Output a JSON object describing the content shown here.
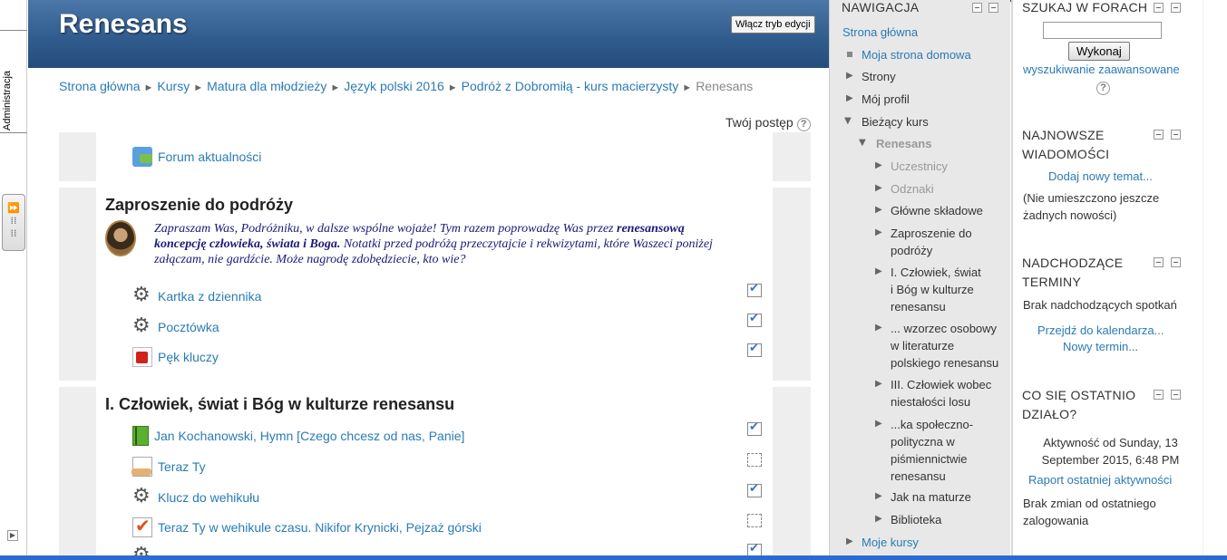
{
  "dock": {
    "admin_label": "Administracja",
    "handle_glyph": "⏩",
    "bottom_glyph": "▶"
  },
  "header": {
    "site_title": "Renesans",
    "edit_button": "Włącz tryb edycji"
  },
  "breadcrumb": {
    "items": [
      "Strona główna",
      "Kursy",
      "Matura dla młodzieży",
      "Język polski 2016",
      "Podróż z Dobromiłą - kurs macierzysty"
    ],
    "current": "Renesans",
    "separator": "►"
  },
  "progress": {
    "label": "Twój postęp",
    "help": "?"
  },
  "sections": {
    "s0": {
      "activities": [
        {
          "label": "Forum aktualności",
          "icon": "forum-icon"
        }
      ]
    },
    "s1": {
      "title": "Zaproszenie do podróży",
      "intro_a": "Zapraszam Was, Podróżniku, w dalsze wspólne wojaże! Tym razem poprowadzę Was przez ",
      "intro_b": "renesansową koncepcję człowieka, świata i Boga.",
      "intro_c": " Notatki przed podróżą przeczytajcie i rekwizytami, które Waszeci poniżej załączam, nie gardźcie. Może nagrodę zdobędziecie, kto wie?",
      "activities": [
        {
          "label": "Kartka z dziennika",
          "icon": "gear-icon",
          "done": true
        },
        {
          "label": "Pocztówka",
          "icon": "gear-icon",
          "done": true
        },
        {
          "label": "Pęk kluczy",
          "icon": "pdf-icon",
          "done": true
        }
      ]
    },
    "s2": {
      "title": "I. Człowiek, świat i Bóg w kulturze renesansu",
      "activities": [
        {
          "label": "Jan Kochanowski, Hymn [Czego chcesz od nas, Panie]",
          "icon": "book-icon",
          "done": true
        },
        {
          "label": "Teraz Ty",
          "icon": "assignment-icon",
          "done": false
        },
        {
          "label": "Klucz do wehikułu",
          "icon": "gear-icon",
          "done": true
        },
        {
          "label": "Teraz Ty w wehikule czasu. Nikifor Krynicki, Pejzaż górski",
          "icon": "quiz-icon",
          "done": false
        }
      ]
    }
  },
  "navigation": {
    "title": "NAWIGACJA",
    "home": "Strona główna",
    "my_home": "Moja strona domowa",
    "pages": "Strony",
    "profile": "Mój profil",
    "current_course": "Bieżący kurs",
    "course_name": "Renesans",
    "participants": "Uczestnicy",
    "badges": "Odznaki",
    "general": "Główne składowe",
    "topic1": "Zaproszenie do podróży",
    "topic2": "I. Człowiek, świat i Bóg w kulturze renesansu",
    "topic3": "... wzorzec osobowy w literaturze polskiego renesansu",
    "topic4": "III. Człowiek wobec niestałości losu",
    "topic5": "...ka społeczno-polityczna w piśmiennictwie renesansu",
    "topic6": "Jak na maturze",
    "topic7": "Biblioteka",
    "my_courses": "Moje kursy"
  },
  "search_forums": {
    "title": "SZUKAJ W FORACH",
    "button": "Wykonaj",
    "advanced": "wyszukiwanie zaawansowane",
    "help": "?"
  },
  "latest_news": {
    "title": "NAJNOWSZE WIADOMOŚCI",
    "add": "Dodaj nowy temat...",
    "empty": "(Nie umieszczono jeszcze żadnych nowości)"
  },
  "upcoming": {
    "title": "NADCHODZĄCE TERMINY",
    "empty": "Brak nadchodzących spotkań",
    "calendar": "Przejdź do kalendarza...",
    "new_event": "Nowy termin..."
  },
  "recent": {
    "title": "CO SIĘ OSTATNIO DZIAŁO?",
    "activity_since": "Aktywność od Sunday, 13 September 2015, 6:48 PM",
    "report": "Raport ostatniej aktywności",
    "no_changes": "Brak zmian od ostatniego zalogowania"
  }
}
